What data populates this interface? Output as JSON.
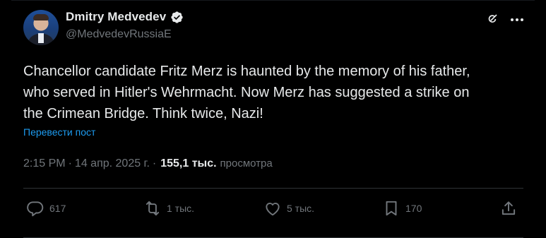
{
  "author": {
    "display_name": "Dmitry Medvedev",
    "handle": "@MedvedevRussiaE",
    "verified": true
  },
  "tweet": {
    "text": "Chancellor candidate Fritz Merz is haunted by the memory of his father,\nwho served in Hitler's Wehrmacht. Now Merz has suggested a strike on\nthe Crimean Bridge. Think twice, Nazi!",
    "translate_label": "Перевести пост"
  },
  "meta": {
    "time": "2:15 PM",
    "separator": "·",
    "date": "14 апр. 2025 г.",
    "separator2": "·",
    "views_count": "155,1 тыс.",
    "views_label": "просмотра"
  },
  "actions": {
    "replies": "617",
    "reposts": "1 тыс.",
    "likes": "5 тыс.",
    "bookmarks": "170"
  },
  "icons": {
    "header": [
      "grok-icon",
      "more-icon",
      "verified-badge-icon"
    ],
    "actions": [
      "reply-icon",
      "repost-icon",
      "like-icon",
      "bookmark-icon",
      "share-icon"
    ]
  },
  "colors": {
    "background": "#000000",
    "text_primary": "#e7e9ea",
    "text_secondary": "#71767b",
    "link": "#1d9bf0",
    "divider": "#2f3336"
  }
}
